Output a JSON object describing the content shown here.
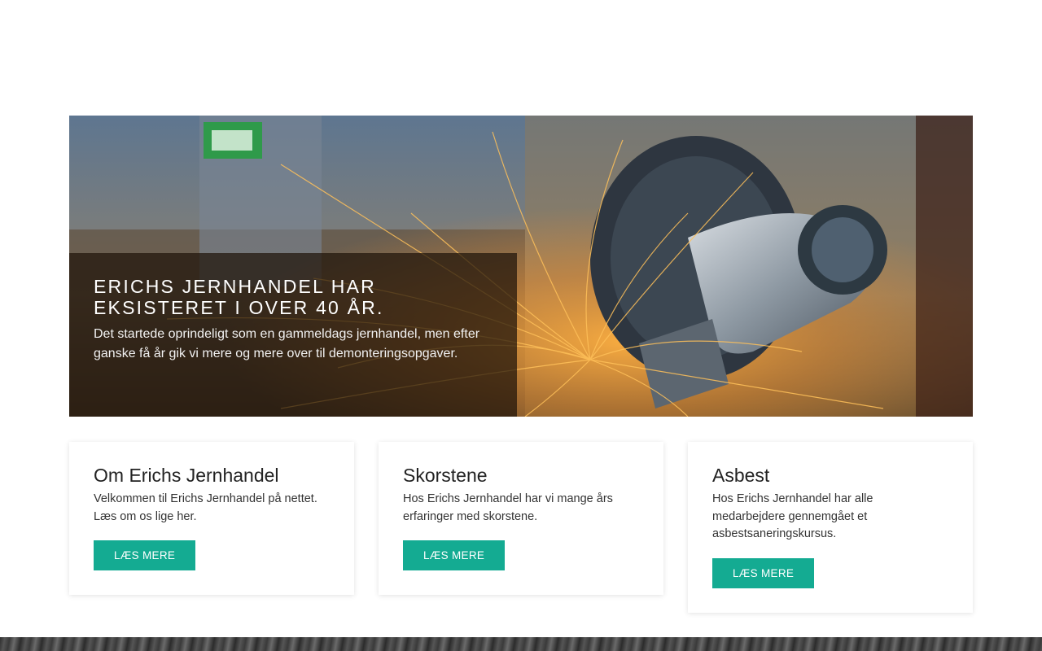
{
  "hero": {
    "title": "Erichs Jernhandel har eksisteret i over 40 år.",
    "text": "Det startede oprindeligt som en gammeldags jernhandel, men efter ganske få år gik vi mere og mere over til demonteringsopgaver."
  },
  "cards": [
    {
      "title": "Om Erichs Jernhandel",
      "text": "Velkommen til Erichs Jernhandel på nettet. Læs om os lige her.",
      "button": "LÆS MERE"
    },
    {
      "title": "Skorstene",
      "text": "Hos Erichs Jernhandel har vi mange års erfaringer med skorstene.",
      "button": "LÆS MERE"
    },
    {
      "title": "Asbest",
      "text": "Hos Erichs Jernhandel har alle medarbejdere gennemgået et asbestsaneringskursus.",
      "button": "LÆS MERE"
    }
  ],
  "colors": {
    "accent": "#14ab92",
    "overlay": "#1e140a"
  }
}
